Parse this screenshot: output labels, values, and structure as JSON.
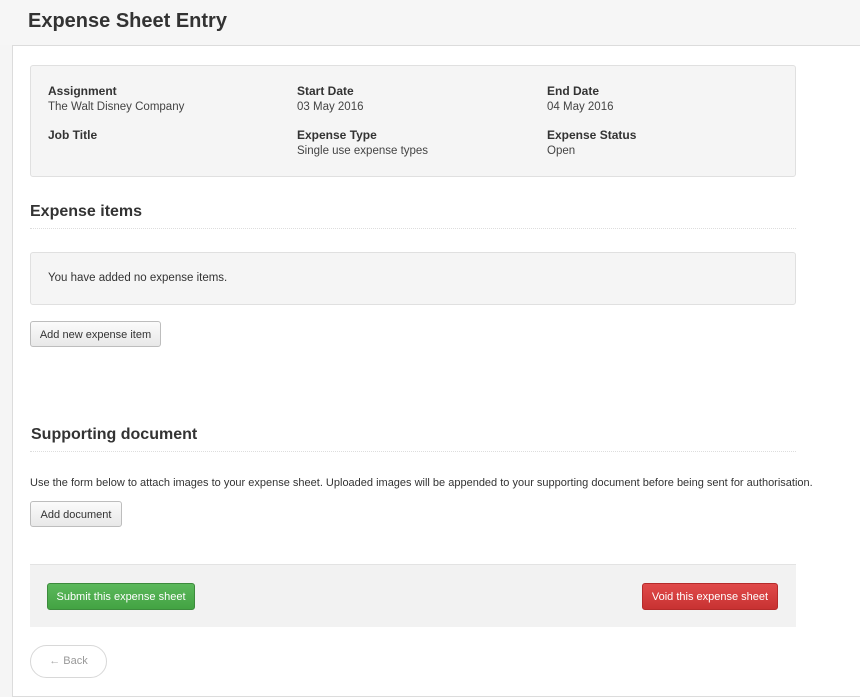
{
  "header": {
    "title": "Expense Sheet Entry"
  },
  "summary": {
    "assignment": {
      "label": "Assignment",
      "value": "The Walt Disney Company"
    },
    "start_date": {
      "label": "Start Date",
      "value": "03 May 2016"
    },
    "end_date": {
      "label": "End Date",
      "value": "04 May 2016"
    },
    "job_title": {
      "label": "Job Title",
      "value": ""
    },
    "expense_type": {
      "label": "Expense Type",
      "value": "Single use expense types"
    },
    "expense_status": {
      "label": "Expense Status",
      "value": "Open"
    }
  },
  "expense_items": {
    "title": "Expense items",
    "empty_message": "You have added no expense items.",
    "add_label": "Add new expense item"
  },
  "supporting_document": {
    "title": "Supporting document",
    "help_text": "Use the form below to attach images to your expense sheet. Uploaded images will be appended to your supporting document before being sent for authorisation.",
    "add_label": "Add document"
  },
  "actions": {
    "submit_label": "Submit this expense sheet",
    "void_label": "Void this expense sheet",
    "back_label": "Back",
    "back_icon": "left-arrow-icon"
  },
  "colors": {
    "submit": "#5cb85c",
    "void": "#d9534f"
  }
}
